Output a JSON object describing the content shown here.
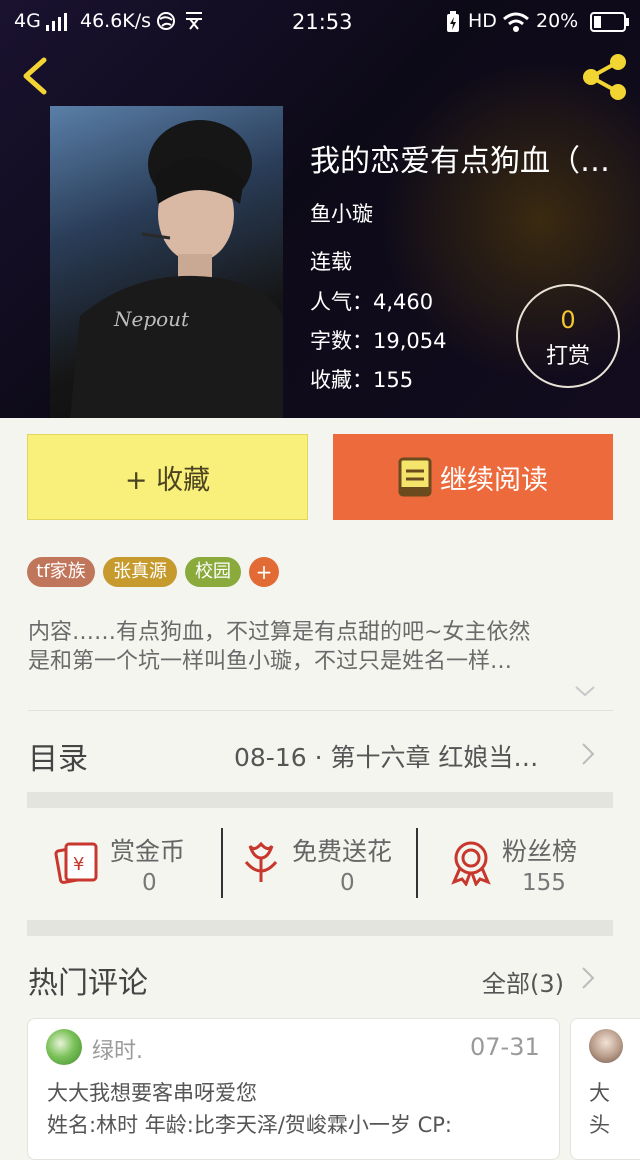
{
  "status_bar": {
    "network": "4G",
    "speed": "46.6K/s",
    "time": "21:53",
    "hd": "HD",
    "battery": "20%"
  },
  "book": {
    "title": "我的恋爱有点狗血（…",
    "author": "鱼小璇",
    "status": "连载",
    "popularity_label": "人气：",
    "popularity": "4,460",
    "words_label": "字数：",
    "words": "19,054",
    "favorites_label": "收藏：",
    "favorites": "155",
    "cover_shirt_text": "Nepout"
  },
  "reward": {
    "count": "0",
    "label": "打赏"
  },
  "actions": {
    "favorite_label": "+ 收藏",
    "read_label": "继续阅读"
  },
  "tags": [
    {
      "label": "tf家族",
      "color": "#c0765a"
    },
    {
      "label": "张真源",
      "color": "#c79a2d"
    },
    {
      "label": "校园",
      "color": "#8aab3c"
    },
    {
      "label": "+",
      "color": "#e26a34"
    }
  ],
  "description": {
    "line1": "内容……有点狗血，不过算是有点甜的吧~女主依然",
    "line2": "是和第一个坑一样叫鱼小璇，不过只是姓名一样…"
  },
  "toc": {
    "title": "目录",
    "latest": "08-16 · 第十六章 红娘当…"
  },
  "stats": [
    {
      "label": "赏金币",
      "value": "0",
      "icon": "coin-envelope-icon"
    },
    {
      "label": "免费送花",
      "value": "0",
      "icon": "flower-icon"
    },
    {
      "label": "粉丝榜",
      "value": "155",
      "icon": "medal-icon"
    }
  ],
  "comments": {
    "title": "热门评论",
    "all_label": "全部(3)",
    "items": [
      {
        "user": "绿时.",
        "date": "07-31",
        "line1": "大大我想要客串呀爱您",
        "line2": "姓名:林时 年龄:比李天泽/贺峻霖小一岁 CP:"
      },
      {
        "line1": "大",
        "line2": "头"
      }
    ]
  },
  "colors": {
    "accent_orange": "#ec6a3b",
    "accent_yellow": "#f8f07a",
    "icon_red": "#c8372d",
    "gold": "#f2c531"
  }
}
